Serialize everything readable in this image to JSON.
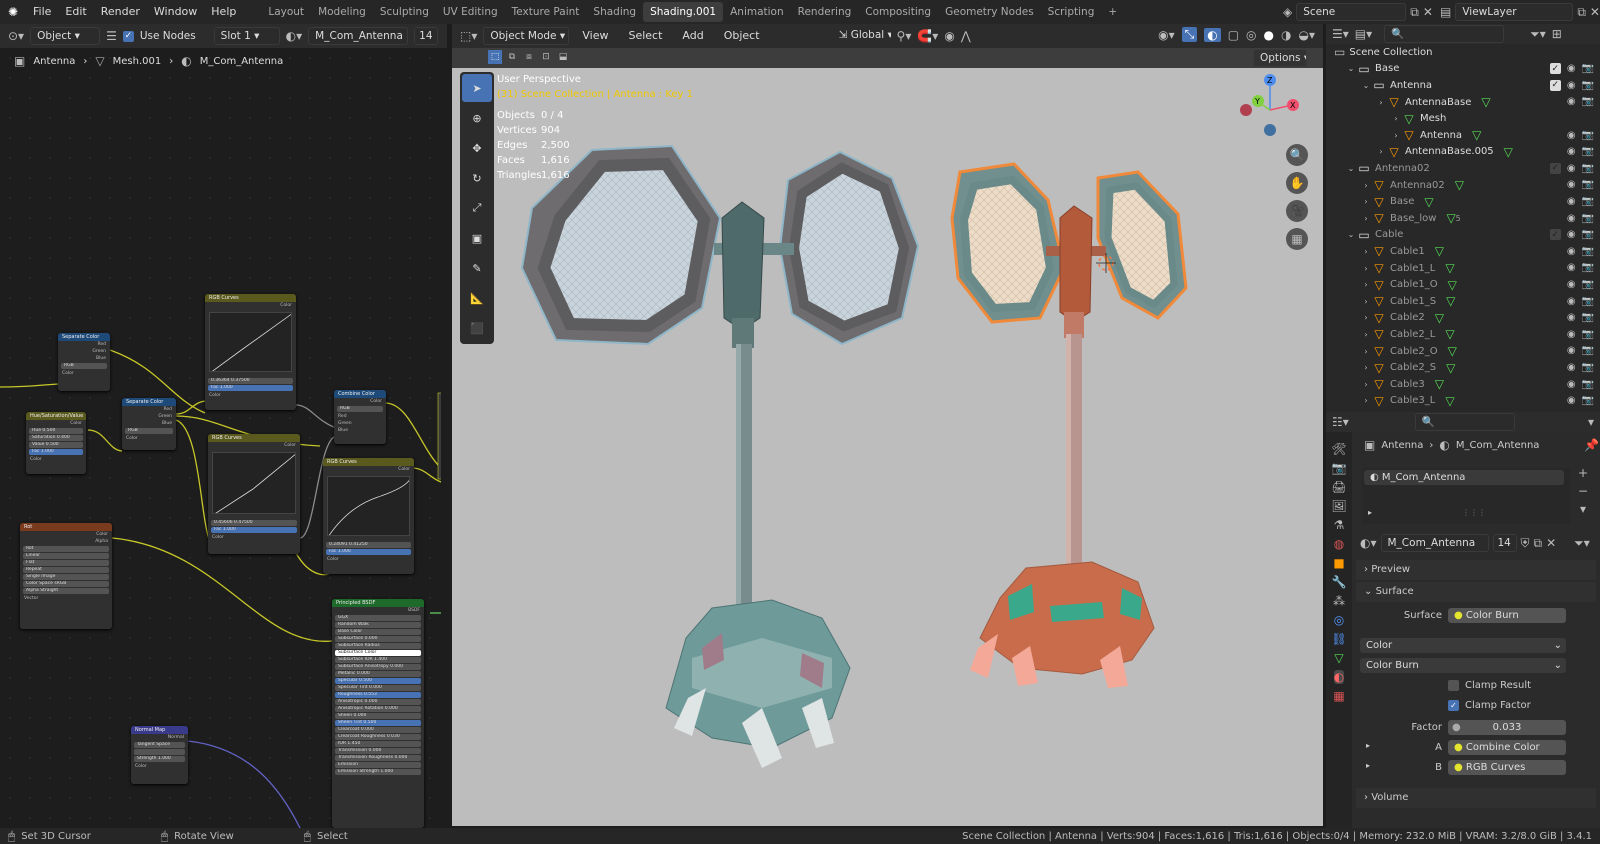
{
  "topbar": {
    "menus": [
      "File",
      "Edit",
      "Render",
      "Window",
      "Help"
    ],
    "workspaces": [
      "Layout",
      "Modeling",
      "Sculpting",
      "UV Editing",
      "Texture Paint",
      "Shading",
      "Shading.001",
      "Animation",
      "Rendering",
      "Compositing",
      "Geometry Nodes",
      "Scripting"
    ],
    "active_workspace": "Shading.001",
    "add": "+",
    "scene": "Scene",
    "view_layer": "ViewLayer"
  },
  "node_header": {
    "object": "Object",
    "use_nodes": "Use Nodes",
    "slot": "Slot 1",
    "material": "M_Com_Antenna",
    "users": "14"
  },
  "breadcrumb": {
    "object": "Antenna",
    "mesh": "Mesh.001",
    "material": "M_Com_Antenna"
  },
  "nodes": {
    "separate1": {
      "title": "Separate Color",
      "outs": [
        "Red",
        "Green",
        "Blue"
      ],
      "mode": "RGB",
      "in": "Color"
    },
    "hsv": {
      "title": "Hue/Saturation/Value",
      "out": "Color",
      "rows": [
        "Hue 0.500",
        "Saturation 0.400",
        "Value 0.500",
        "Fac 1.000"
      ],
      "in": "Color"
    },
    "separate2": {
      "title": "Separate Color",
      "outs": [
        "Red",
        "Green",
        "Blue"
      ],
      "mode": "RGB",
      "in": "Color"
    },
    "curves1": {
      "title": "RGB Curves",
      "out": "Color",
      "vals": "0.36364   0.37500",
      "fac": "Fac 1.000",
      "in": "Color"
    },
    "curves2": {
      "title": "RGB Curves",
      "out": "Color",
      "vals": "0.45606   0.47500",
      "fac": "Fac 1.000",
      "in": "Color"
    },
    "curves3": {
      "title": "RGB Curves",
      "out": "Color",
      "vals": "0.24091   0.41250",
      "fac": "Fac 1.000",
      "in": "Color"
    },
    "combine": {
      "title": "Combine Color",
      "out": "Color",
      "mode": "RGB",
      "ins": [
        "Red",
        "Green",
        "Blue"
      ]
    },
    "image": {
      "title": "Rot",
      "outs": [
        "Color",
        "Alpha"
      ],
      "file": "Rot",
      "rows": [
        "Linear",
        "Flat",
        "Repeat",
        "Single Image",
        "Color Space sRGB",
        "Alpha Straight"
      ],
      "in": "Vector"
    },
    "bsdf": {
      "title": "Principled BSDF",
      "out": "BSDF",
      "rows": [
        "GGX",
        "Random Walk",
        "Base Color",
        "Subsurface 0.000",
        "Subsurface Radius",
        "Subsurface Color",
        "Subsurface IOR 1.400",
        "Subsurface Anisotropy 0.000",
        "Metallic 0.000",
        "Specular 0.500",
        "Specular Tint 0.000",
        "Roughness 0.553",
        "Anisotropic 0.000",
        "Anisotropic Rotation 0.000",
        "Sheen 0.000",
        "Sheen Tint 0.500",
        "Clearcoat 0.000",
        "Clearcoat Roughness 0.030",
        "IOR 1.450",
        "Transmission 0.000",
        "Transmission Roughness 0.000",
        "Emission",
        "Emission Strength 1.000"
      ]
    },
    "normal": {
      "title": "Normal Map",
      "out": "Normal",
      "space": "Tangent Space",
      "strength": "Strength 1.000",
      "color": "Color"
    }
  },
  "viewport_header": {
    "mode": "Object Mode",
    "menus": [
      "View",
      "Select",
      "Add",
      "Object"
    ],
    "orientation": "Global",
    "options": "Options"
  },
  "overlay": {
    "title": "User Perspective",
    "subtitle": "(31) Scene Collection | Antenna : Key 1",
    "stats": [
      {
        "k": "Objects",
        "v": "0 / 4"
      },
      {
        "k": "Vertices",
        "v": "904"
      },
      {
        "k": "Edges",
        "v": "2,500"
      },
      {
        "k": "Faces",
        "v": "1,616"
      },
      {
        "k": "Triangles",
        "v": "1,616"
      }
    ]
  },
  "gizmo": {
    "x": "X",
    "y": "Y",
    "z": "Z"
  },
  "outliner": {
    "root": "Scene Collection",
    "rows": [
      {
        "label": "Base",
        "indent": 1,
        "type": "collection",
        "dim": false
      },
      {
        "label": "Antenna",
        "indent": 2,
        "type": "collection",
        "dim": false
      },
      {
        "label": "AntennaBase",
        "indent": 3,
        "type": "object",
        "dim": false
      },
      {
        "label": "Mesh",
        "indent": 4,
        "type": "mesh",
        "dim": false
      },
      {
        "label": "Antenna",
        "indent": 4,
        "type": "object",
        "dim": false
      },
      {
        "label": "AntennaBase.005",
        "indent": 3,
        "type": "object",
        "dim": false
      },
      {
        "label": "Antenna02",
        "indent": 1,
        "type": "collection",
        "dim": true
      },
      {
        "label": "Antenna02",
        "indent": 2,
        "type": "object",
        "dim": true
      },
      {
        "label": "Base",
        "indent": 2,
        "type": "object",
        "dim": true
      },
      {
        "label": "Base_low",
        "indent": 2,
        "type": "object",
        "dim": true
      },
      {
        "label": "Cable",
        "indent": 1,
        "type": "collection",
        "dim": true
      },
      {
        "label": "Cable1",
        "indent": 2,
        "type": "object",
        "dim": true
      },
      {
        "label": "Cable1_L",
        "indent": 2,
        "type": "object",
        "dim": true
      },
      {
        "label": "Cable1_O",
        "indent": 2,
        "type": "object",
        "dim": true
      },
      {
        "label": "Cable1_S",
        "indent": 2,
        "type": "object",
        "dim": true
      },
      {
        "label": "Cable2",
        "indent": 2,
        "type": "object",
        "dim": true
      },
      {
        "label": "Cable2_L",
        "indent": 2,
        "type": "object",
        "dim": true
      },
      {
        "label": "Cable2_O",
        "indent": 2,
        "type": "object",
        "dim": true
      },
      {
        "label": "Cable2_S",
        "indent": 2,
        "type": "object",
        "dim": true
      },
      {
        "label": "Cable3",
        "indent": 2,
        "type": "object",
        "dim": true
      },
      {
        "label": "Cable3_L",
        "indent": 2,
        "type": "object",
        "dim": true
      }
    ],
    "base_low_count": "5"
  },
  "properties": {
    "breadcrumb_object": "Antenna",
    "breadcrumb_material": "M_Com_Antenna",
    "slot": "M_Com_Antenna",
    "material": "M_Com_Antenna",
    "users": "14",
    "preview": "Preview",
    "surface_panel": "Surface",
    "surface_label": "Surface",
    "surface_value": "Color Burn",
    "color_type": "Color",
    "blend_mode": "Color Burn",
    "clamp_result": "Clamp Result",
    "clamp_factor": "Clamp Factor",
    "factor_label": "Factor",
    "factor_value": "0.033",
    "a_label": "A",
    "a_value": "Combine Color",
    "b_label": "B",
    "b_value": "RGB Curves",
    "volume": "Volume"
  },
  "statusbar": {
    "left1": "Set 3D Cursor",
    "left2": "Rotate View",
    "left3": "Select",
    "right": "Scene Collection | Antenna | Verts:904 | Faces:1,616 | Tris:1,616 | Objects:0/4 | Memory: 232.0 MiB | VRAM: 3.2/8.0 GiB | 3.4.1"
  },
  "colors": {
    "accent": "#4772b3",
    "header_blue": "#1e4a7a",
    "selected_text": "#ffcc00"
  }
}
